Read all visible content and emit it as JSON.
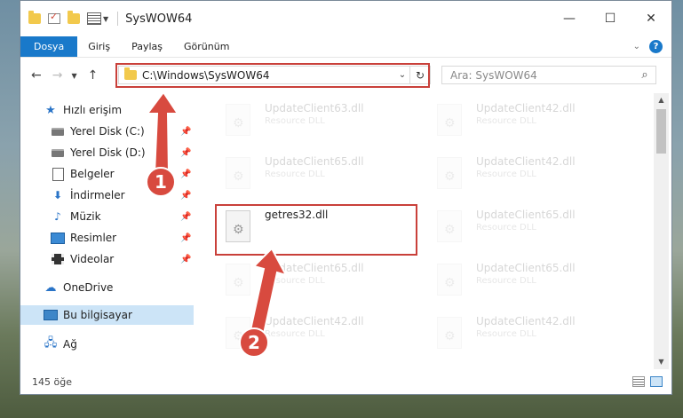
{
  "window": {
    "title": "SysWOW64",
    "minimize": "—",
    "maximize": "☐",
    "close": "✕"
  },
  "ribbon": {
    "tabs": [
      "Dosya",
      "Giriş",
      "Paylaş",
      "Görünüm"
    ],
    "help": "?"
  },
  "navigation": {
    "back": "←",
    "forward": "→",
    "recent": "▼",
    "up": "↑",
    "address": "C:\\Windows\\SysWOW64",
    "address_dropdown": "⌄",
    "refresh": "↻",
    "search_placeholder": "Ara: SysWOW64",
    "search_icon": "⌕"
  },
  "sidebar": {
    "quick_access": "Hızlı erişim",
    "items": [
      {
        "label": "Yerel Disk (C:)"
      },
      {
        "label": "Yerel Disk (D:)"
      },
      {
        "label": "Belgeler"
      },
      {
        "label": "İndirmeler"
      },
      {
        "label": "Müzik"
      },
      {
        "label": "Resimler"
      },
      {
        "label": "Videolar"
      }
    ],
    "onedrive": "OneDrive",
    "this_pc": "Bu bilgisayar",
    "network": "Ağ"
  },
  "files": [
    {
      "name": "UpdateClient63.dll",
      "type": "Resource DLL"
    },
    {
      "name": "UpdateClient42.dll",
      "type": "Resource DLL"
    },
    {
      "name": "UpdateClient65.dll",
      "type": "Resource DLL"
    },
    {
      "name": "UpdateClient42.dll",
      "type": "Resource DLL"
    },
    {
      "name": "getres32.dll",
      "type": ""
    },
    {
      "name": "UpdateClient65.dll",
      "type": "Resource DLL"
    },
    {
      "name": "UpdateClient65.dll",
      "type": "Resource DLL"
    },
    {
      "name": "UpdateClient65.dll",
      "type": "Resource DLL"
    },
    {
      "name": "UpdateClient42.dll",
      "type": "Resource DLL"
    },
    {
      "name": "UpdateClient42.dll",
      "type": "Resource DLL"
    }
  ],
  "status": {
    "count": "145 öğe"
  },
  "annotations": {
    "step1": "1",
    "step2": "2",
    "color": "#d84a3f"
  },
  "colors": {
    "accent": "#1979ca",
    "highlight_border": "#c9403a",
    "selected_bg": "#cce4f7"
  }
}
